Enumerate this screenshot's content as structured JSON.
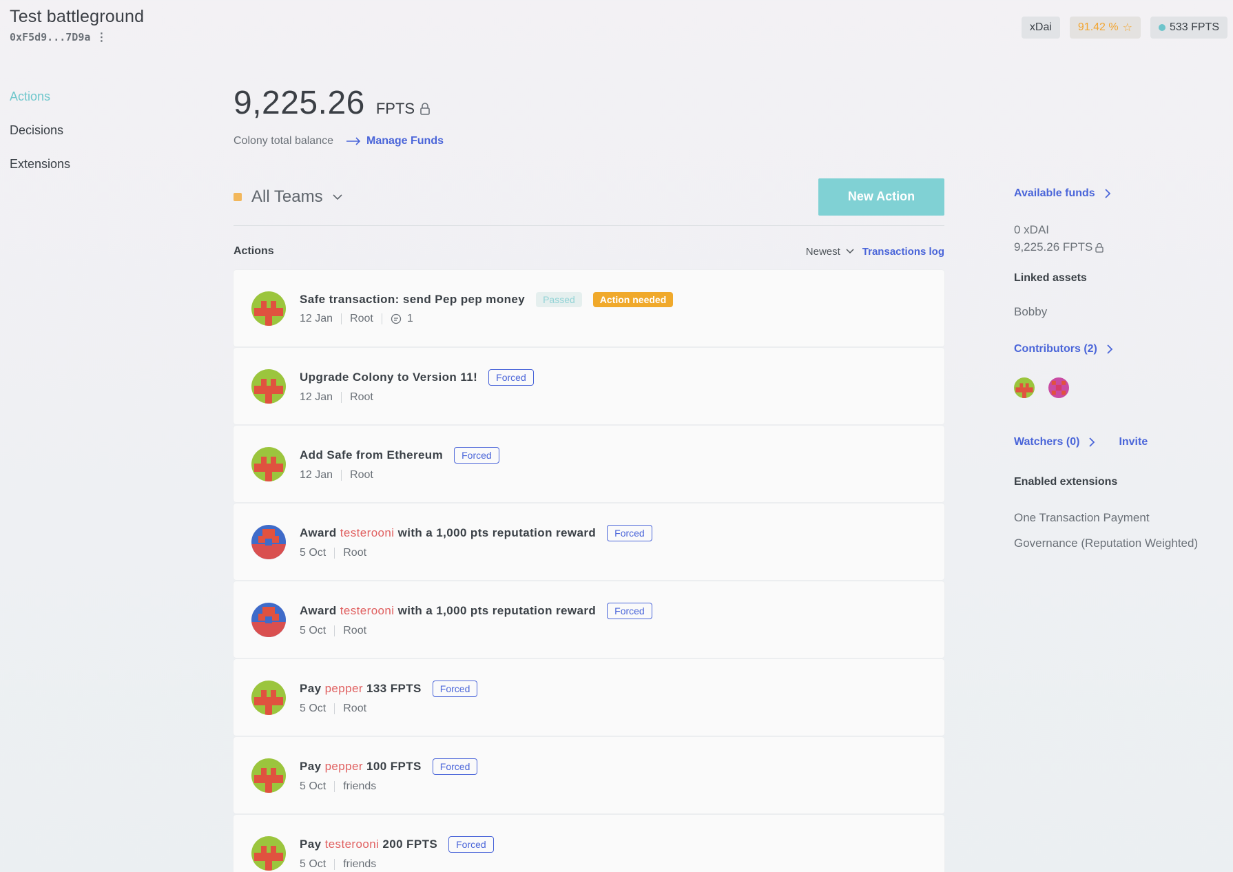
{
  "colony": {
    "name": "Test battleground",
    "address": "0xF5d9...7D9a",
    "kebab": "⋮"
  },
  "top_bar": {
    "network": "xDai",
    "reputation": "91.42 %",
    "star": "☆",
    "user_balance": "533 FPTS"
  },
  "nav": {
    "items": [
      {
        "label": "Actions",
        "active": true
      },
      {
        "label": "Decisions",
        "active": false
      },
      {
        "label": "Extensions",
        "active": false
      }
    ]
  },
  "balance": {
    "amount": "9,225.26",
    "token": "FPTS",
    "subtitle": "Colony total balance",
    "manage_label": "Manage Funds"
  },
  "team_filter": {
    "label": "All Teams",
    "new_action_label": "New Action"
  },
  "list": {
    "title": "Actions",
    "sort_label": "Newest",
    "transactions_log": "Transactions log"
  },
  "actions": [
    {
      "title": "Safe transaction: send Pep pep money",
      "date": "12 Jan",
      "team": "Root",
      "comments": "1",
      "badges": [
        "Passed",
        "Action needed"
      ]
    },
    {
      "title": "Upgrade Colony to Version 11!",
      "date": "12 Jan",
      "team": "Root",
      "badges": [
        "Forced"
      ]
    },
    {
      "title": "Add Safe from Ethereum",
      "date": "12 Jan",
      "team": "Root",
      "badges": [
        "Forced"
      ]
    },
    {
      "title_pre": "Award ",
      "title_hl": "testerooni",
      "title_post": " with a 1,000 pts reputation reward",
      "date": "5 Oct",
      "team": "Root",
      "badges": [
        "Forced"
      ]
    },
    {
      "title_pre": "Award ",
      "title_hl": "testerooni",
      "title_post": " with a 1,000 pts reputation reward",
      "date": "5 Oct",
      "team": "Root",
      "badges": [
        "Forced"
      ]
    },
    {
      "title_pre": "Pay ",
      "title_hl": "pepper",
      "title_post": " 133 FPTS",
      "date": "5 Oct",
      "team": "Root",
      "badges": [
        "Forced"
      ]
    },
    {
      "title_pre": "Pay ",
      "title_hl": "pepper",
      "title_post": " 100 FPTS",
      "date": "5 Oct",
      "team": "friends",
      "badges": [
        "Forced"
      ]
    },
    {
      "title_pre": "Pay ",
      "title_hl": "testerooni",
      "title_post": " 200 FPTS",
      "date": "5 Oct",
      "team": "friends",
      "badges": [
        "Forced"
      ]
    }
  ],
  "sidebar": {
    "available_funds": "Available funds",
    "funds": [
      "0 xDAI",
      "9,225.26 FPTS"
    ],
    "linked_assets_title": "Linked assets",
    "linked_asset": "Bobby",
    "contributors": "Contributors (2)",
    "watchers": "Watchers (0)",
    "invite": "Invite",
    "extensions_title": "Enabled extensions",
    "extensions": [
      "One Transaction Payment",
      "Governance (Reputation Weighted)"
    ]
  },
  "colors": {
    "accent": "#6fc7cc",
    "link": "#4a65d9",
    "highlight": "#e05f5f",
    "warning": "#f0a92b",
    "team": "#f2b75b"
  },
  "icons": {
    "lock": "lock-icon",
    "arrow": "arrow-right-icon",
    "chevron": "chevron-down-icon",
    "comment": "comment-icon"
  }
}
